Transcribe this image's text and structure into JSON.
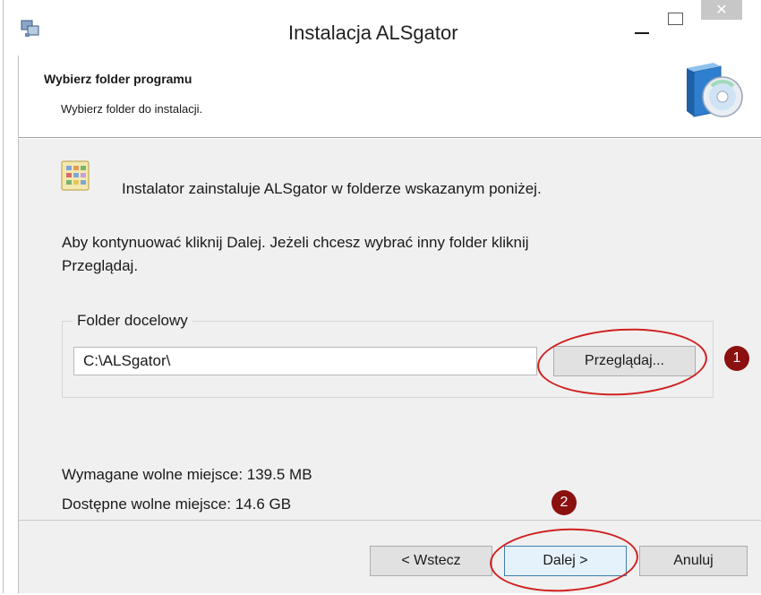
{
  "window": {
    "title": "Instalacja ALSgator",
    "close_glyph": "✕"
  },
  "header": {
    "title": "Wybierz folder programu",
    "subtitle": "Wybierz folder do instalacji."
  },
  "body": {
    "intro": "Instalator zainstaluje ALSgator w folderze wskazanym poniżej.",
    "instructions_line1": "Aby kontynuować kliknij Dalej. Jeżeli chcesz wybrać inny folder kliknij",
    "instructions_line2": "Przeglądaj.",
    "destination_group_label": "Folder docelowy",
    "destination_path": "C:\\ALSgator\\",
    "browse_label": "Przeglądaj...",
    "required_space": "Wymagane wolne miejsce: 139.5 MB",
    "available_space": "Dostępne wolne miejsce: 14.6 GB"
  },
  "footer": {
    "back_label": "< Wstecz",
    "next_label": "Dalej >",
    "cancel_label": "Anuluj"
  },
  "annotations": [
    {
      "badge": "1",
      "target": "browse-button"
    },
    {
      "badge": "2",
      "target": "next-button"
    }
  ],
  "icons": {
    "app": "installer-icon",
    "header": "cd-box-icon",
    "message": "folder-grid-icon"
  },
  "colors": {
    "annotation_ring": "#d02020",
    "annotation_badge": "#8b1010",
    "default_button_border": "#3c7fb1",
    "content_background": "#f0f0f0"
  }
}
